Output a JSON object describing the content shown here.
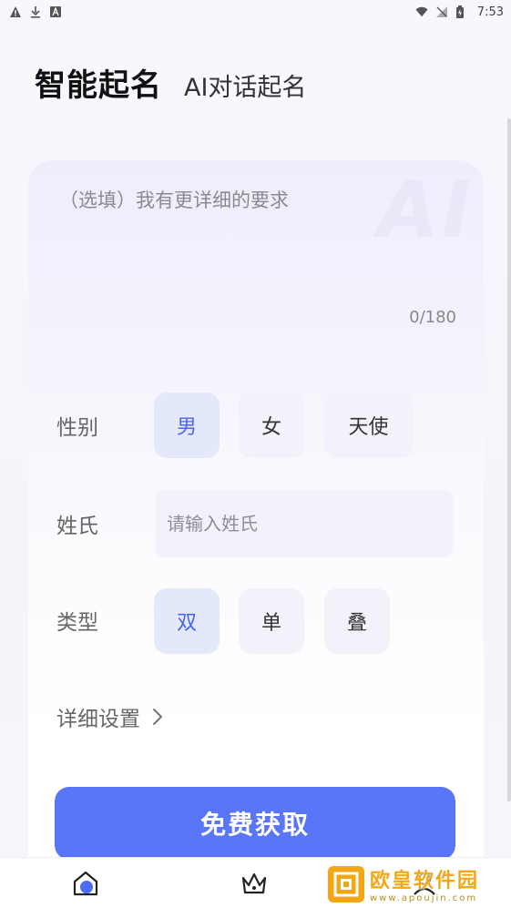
{
  "status_bar": {
    "time": "7:53"
  },
  "header": {
    "title": "智能起名",
    "tab_ai_chat": "AI对话起名"
  },
  "card": {
    "watermark": "AI",
    "detail_placeholder": "（选填）我有更详细的要求",
    "detail_value": "",
    "char_counter": "0/180",
    "gender": {
      "label": "性别",
      "options": [
        "男",
        "女",
        "天使"
      ],
      "selected": "男"
    },
    "surname": {
      "label": "姓氏",
      "placeholder": "请输入姓氏",
      "value": ""
    },
    "type": {
      "label": "类型",
      "options": [
        "双",
        "单",
        "叠"
      ],
      "selected": "双"
    },
    "detail_settings": "详细设置",
    "submit": "免费获取"
  },
  "colors": {
    "accent": "#5876f6",
    "selected_text": "#4b66e8",
    "selected_bg": "#e4e8fb",
    "option_bg": "#f3f2fb"
  },
  "bottom_nav": {
    "items": [
      "home-icon",
      "crown-icon",
      "profile-icon"
    ]
  },
  "site_watermark": {
    "title": "欧皇软件园",
    "url": "www.apoujin.com"
  }
}
